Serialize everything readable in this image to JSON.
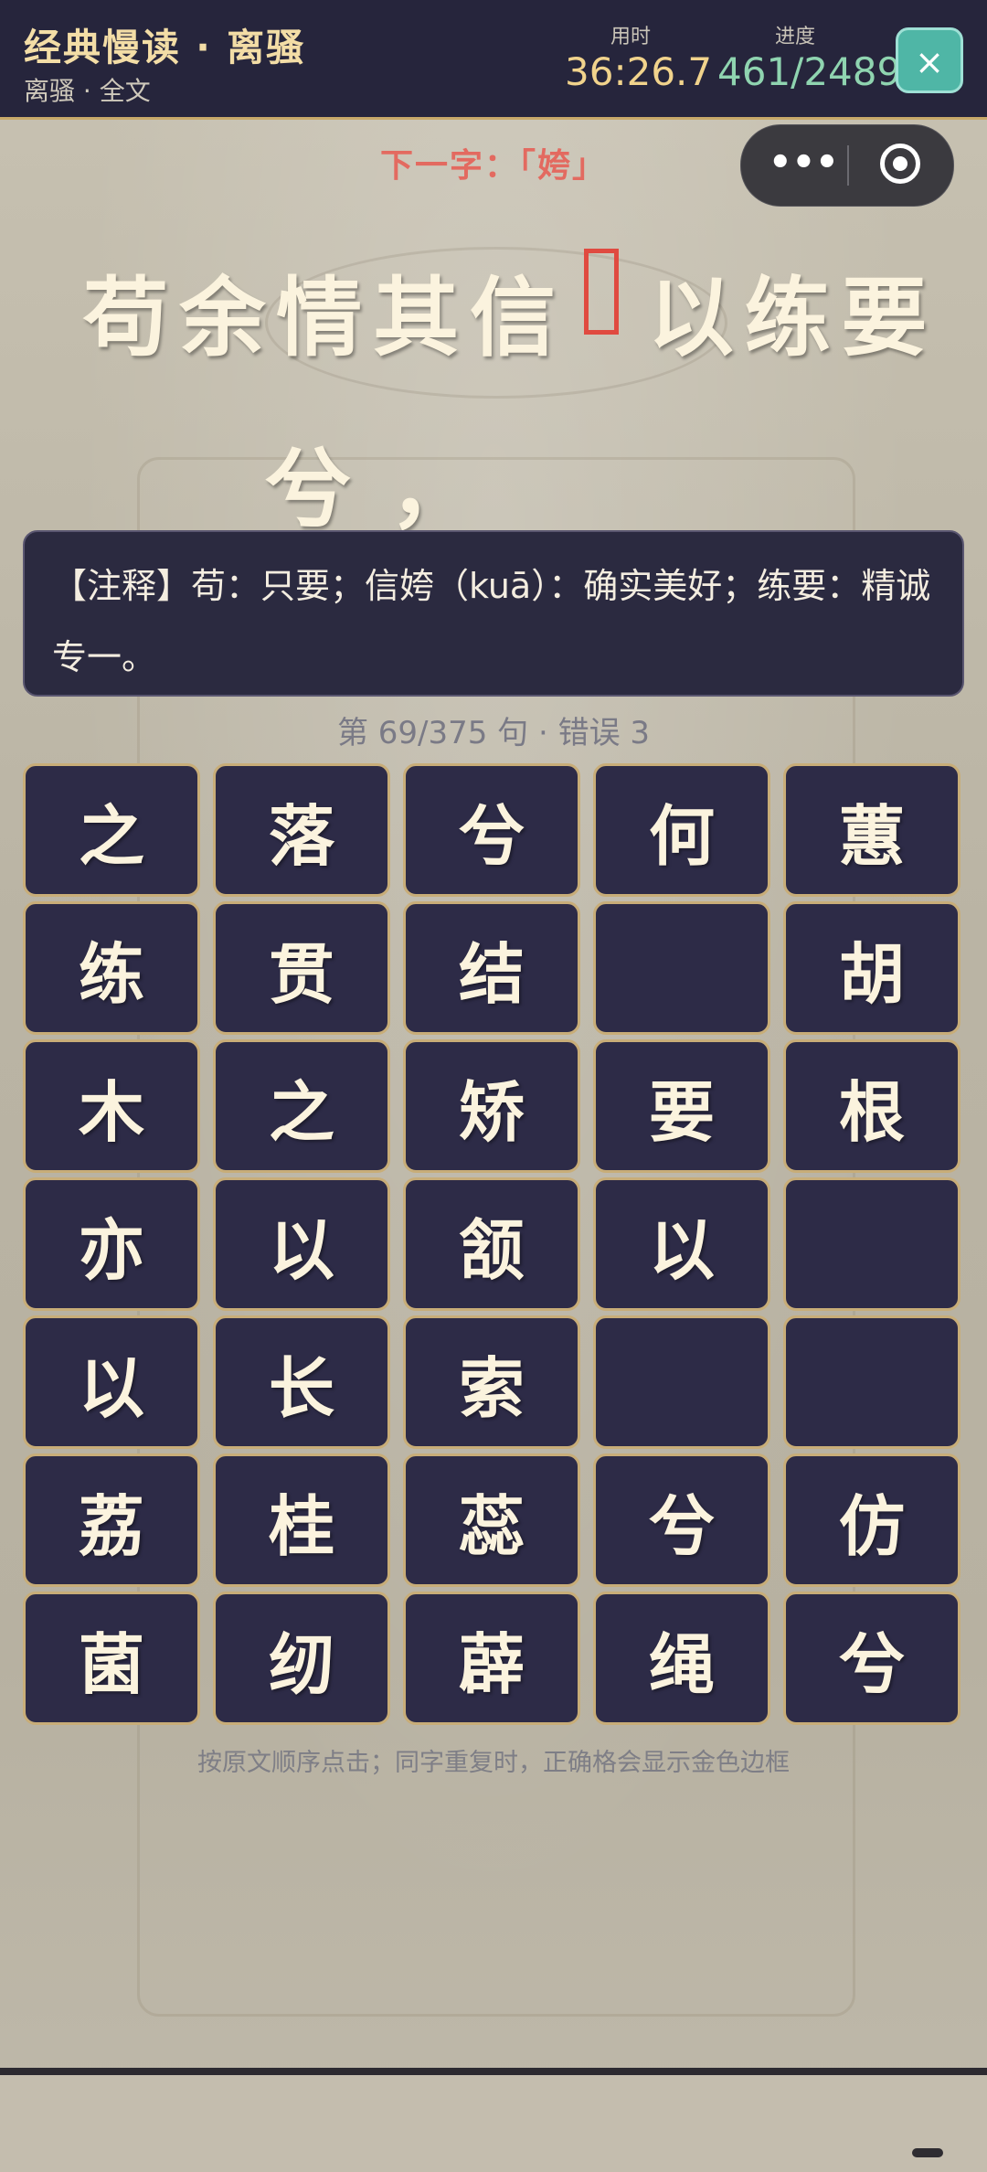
{
  "header": {
    "title": "经典慢读 · 离骚",
    "subtitle": "离骚 · 全文",
    "time_label": "用时",
    "time_value": "36:26.7",
    "progress_label": "进度",
    "progress_value": "461/2489",
    "close_label": "×",
    "colors": {
      "title": "#f3dda6",
      "time": "#f1d38c",
      "progress": "#8fd4b0"
    }
  },
  "next_hint": "下一字：「姱」",
  "capsule": {
    "more_label": "•••",
    "icons": [
      "more-icon",
      "target-icon"
    ]
  },
  "verse": {
    "line1_before": [
      "苟",
      "余",
      "情",
      "其",
      "信"
    ],
    "line1_after": [
      "以",
      "练",
      "要"
    ],
    "line2": [
      "兮",
      "，"
    ]
  },
  "note": "【注释】苟：只要；信姱（kuā）：确实美好；练要：精诚专一。",
  "status": "第 69/375 句 · 错误 3",
  "tiles": [
    "之",
    "落",
    "兮",
    "何",
    "蕙",
    "练",
    "贯",
    "结",
    "",
    "胡",
    "木",
    "之",
    "矫",
    "要",
    "根",
    "亦",
    "以",
    "颔",
    "以",
    "",
    "以",
    "长",
    "索",
    "",
    "",
    "荔",
    "桂",
    "蕊",
    "兮",
    "仿",
    "菌",
    "纫",
    "薜",
    "绳",
    "兮"
  ],
  "footer_hint": "按原文顺序点击；同字重复时，正确格会显示金色边框"
}
